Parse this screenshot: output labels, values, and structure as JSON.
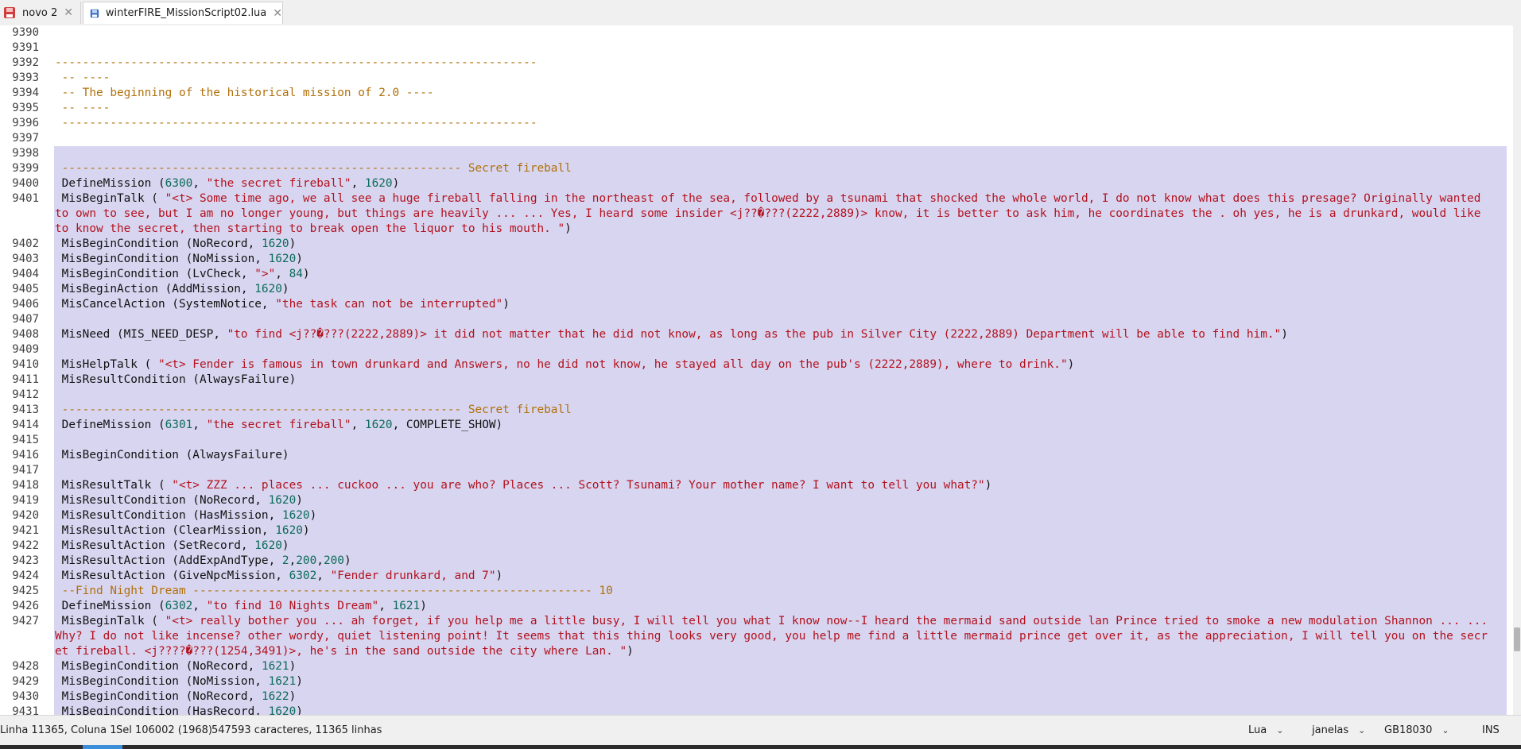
{
  "tabs": [
    {
      "label": "novo 2",
      "icon": "file-modified-icon",
      "color": "#d23c3c"
    },
    {
      "label": "winterFIRE_MissionScript02.lua",
      "icon": "file-saved-icon",
      "color": "#3c72c8"
    }
  ],
  "close_glyph": "✕",
  "editor": {
    "lines": [
      {
        "n": "9390",
        "sel": false,
        "parts": []
      },
      {
        "n": "9391",
        "sel": false,
        "parts": []
      },
      {
        "n": "9392",
        "sel": false,
        "parts": [
          {
            "t": "----------------------------------------------------------------------",
            "k": "c"
          }
        ]
      },
      {
        "n": "9393",
        "sel": false,
        "parts": [
          {
            "t": " -- ----",
            "k": "c"
          }
        ]
      },
      {
        "n": "9394",
        "sel": false,
        "parts": [
          {
            "t": " -- The beginning of the historical mission of 2.0 ----",
            "k": "c"
          }
        ]
      },
      {
        "n": "9395",
        "sel": false,
        "parts": [
          {
            "t": " -- ----",
            "k": "c"
          }
        ]
      },
      {
        "n": "9396",
        "sel": false,
        "parts": [
          {
            "t": " ---------------------------------------------------------------------",
            "k": "c"
          }
        ]
      },
      {
        "n": "9397",
        "sel": false,
        "parts": []
      },
      {
        "n": "9398",
        "sel": true,
        "parts": []
      },
      {
        "n": "9399",
        "sel": true,
        "parts": [
          {
            "t": " ---------------------------------------------------------- Secret fireball",
            "k": "c"
          }
        ]
      },
      {
        "n": "9400",
        "sel": true,
        "parts": [
          {
            "t": " DefineMission (",
            "k": ""
          },
          {
            "t": "6300",
            "k": "n"
          },
          {
            "t": ", ",
            "k": ""
          },
          {
            "t": "\"the secret fireball\"",
            "k": "s"
          },
          {
            "t": ", ",
            "k": ""
          },
          {
            "t": "1620",
            "k": "n"
          },
          {
            "t": ")",
            "k": ""
          }
        ]
      },
      {
        "n": "9401",
        "sel": true,
        "parts": [
          {
            "t": " MisBeginTalk ( ",
            "k": ""
          },
          {
            "t": "\"<t> Some time ago, we all see a huge fireball falling in the northeast of the sea, followed by a tsunami that shocked the whole world, I do not know what does this presage? Originally wanted to own to see, but I am no longer young, but things are heavily ... ... Yes, I heard some insider <j??�???(2222,2889)> know, it is better to ask him, he coordinates the . oh yes, he is a drunkard, would like to know the secret, then starting to break open the liquor to his mouth. \"",
            "k": "s"
          },
          {
            "t": ")",
            "k": ""
          }
        ]
      },
      {
        "n": "9402",
        "sel": true,
        "parts": [
          {
            "t": " MisBeginCondition (NoRecord, ",
            "k": ""
          },
          {
            "t": "1620",
            "k": "n"
          },
          {
            "t": ")",
            "k": ""
          }
        ]
      },
      {
        "n": "9403",
        "sel": true,
        "parts": [
          {
            "t": " MisBeginCondition (NoMission, ",
            "k": ""
          },
          {
            "t": "1620",
            "k": "n"
          },
          {
            "t": ")",
            "k": ""
          }
        ]
      },
      {
        "n": "9404",
        "sel": true,
        "parts": [
          {
            "t": " MisBeginCondition (LvCheck, ",
            "k": ""
          },
          {
            "t": "\">\"",
            "k": "s"
          },
          {
            "t": ", ",
            "k": ""
          },
          {
            "t": "84",
            "k": "n"
          },
          {
            "t": ")",
            "k": ""
          }
        ]
      },
      {
        "n": "9405",
        "sel": true,
        "parts": [
          {
            "t": " MisBeginAction (AddMission, ",
            "k": ""
          },
          {
            "t": "1620",
            "k": "n"
          },
          {
            "t": ")",
            "k": ""
          }
        ]
      },
      {
        "n": "9406",
        "sel": true,
        "parts": [
          {
            "t": " MisCancelAction (SystemNotice, ",
            "k": ""
          },
          {
            "t": "\"the task can not be interrupted\"",
            "k": "s"
          },
          {
            "t": ")",
            "k": ""
          }
        ]
      },
      {
        "n": "9407",
        "sel": true,
        "parts": []
      },
      {
        "n": "9408",
        "sel": true,
        "parts": [
          {
            "t": " MisNeed (MIS_NEED_DESP, ",
            "k": ""
          },
          {
            "t": "\"to find <j??�???(2222,2889)> it did not matter that he did not know, as long as the pub in Silver City (2222,2889) Department will be able to find him.\"",
            "k": "s"
          },
          {
            "t": ")",
            "k": ""
          }
        ]
      },
      {
        "n": "9409",
        "sel": true,
        "parts": []
      },
      {
        "n": "9410",
        "sel": true,
        "parts": [
          {
            "t": " MisHelpTalk ( ",
            "k": ""
          },
          {
            "t": "\"<t> Fender is famous in town drunkard and Answers, no he did not know, he stayed all day on the pub's (2222,2889), where to drink.\"",
            "k": "s"
          },
          {
            "t": ")",
            "k": ""
          }
        ]
      },
      {
        "n": "9411",
        "sel": true,
        "parts": [
          {
            "t": " MisResultCondition (AlwaysFailure)",
            "k": ""
          }
        ]
      },
      {
        "n": "9412",
        "sel": true,
        "parts": []
      },
      {
        "n": "9413",
        "sel": true,
        "parts": [
          {
            "t": " ---------------------------------------------------------- Secret fireball",
            "k": "c"
          }
        ]
      },
      {
        "n": "9414",
        "sel": true,
        "parts": [
          {
            "t": " DefineMission (",
            "k": ""
          },
          {
            "t": "6301",
            "k": "n"
          },
          {
            "t": ", ",
            "k": ""
          },
          {
            "t": "\"the secret fireball\"",
            "k": "s"
          },
          {
            "t": ", ",
            "k": ""
          },
          {
            "t": "1620",
            "k": "n"
          },
          {
            "t": ", COMPLETE_SHOW)",
            "k": ""
          }
        ]
      },
      {
        "n": "9415",
        "sel": true,
        "parts": []
      },
      {
        "n": "9416",
        "sel": true,
        "parts": [
          {
            "t": " MisBeginCondition (AlwaysFailure)",
            "k": ""
          }
        ]
      },
      {
        "n": "9417",
        "sel": true,
        "parts": []
      },
      {
        "n": "9418",
        "sel": true,
        "parts": [
          {
            "t": " MisResultTalk ( ",
            "k": ""
          },
          {
            "t": "\"<t> ZZZ ... places ... cuckoo ... you are who? Places ... Scott? Tsunami? Your mother name? I want to tell you what?\"",
            "k": "s"
          },
          {
            "t": ")",
            "k": ""
          }
        ]
      },
      {
        "n": "9419",
        "sel": true,
        "parts": [
          {
            "t": " MisResultCondition (NoRecord, ",
            "k": ""
          },
          {
            "t": "1620",
            "k": "n"
          },
          {
            "t": ")",
            "k": ""
          }
        ]
      },
      {
        "n": "9420",
        "sel": true,
        "parts": [
          {
            "t": " MisResultCondition (HasMission, ",
            "k": ""
          },
          {
            "t": "1620",
            "k": "n"
          },
          {
            "t": ")",
            "k": ""
          }
        ]
      },
      {
        "n": "9421",
        "sel": true,
        "parts": [
          {
            "t": " MisResultAction (ClearMission, ",
            "k": ""
          },
          {
            "t": "1620",
            "k": "n"
          },
          {
            "t": ")",
            "k": ""
          }
        ]
      },
      {
        "n": "9422",
        "sel": true,
        "parts": [
          {
            "t": " MisResultAction (SetRecord, ",
            "k": ""
          },
          {
            "t": "1620",
            "k": "n"
          },
          {
            "t": ")",
            "k": ""
          }
        ]
      },
      {
        "n": "9423",
        "sel": true,
        "parts": [
          {
            "t": " MisResultAction (AddExpAndType, ",
            "k": ""
          },
          {
            "t": "2",
            "k": "n"
          },
          {
            "t": ",",
            "k": ""
          },
          {
            "t": "200",
            "k": "n"
          },
          {
            "t": ",",
            "k": ""
          },
          {
            "t": "200",
            "k": "n"
          },
          {
            "t": ")",
            "k": ""
          }
        ]
      },
      {
        "n": "9424",
        "sel": true,
        "parts": [
          {
            "t": " MisResultAction (GiveNpcMission, ",
            "k": ""
          },
          {
            "t": "6302",
            "k": "n"
          },
          {
            "t": ", ",
            "k": ""
          },
          {
            "t": "\"Fender drunkard, and 7\"",
            "k": "s"
          },
          {
            "t": ")",
            "k": ""
          }
        ]
      },
      {
        "n": "9425",
        "sel": true,
        "parts": [
          {
            "t": " --Find Night Dream ---------------------------------------------------------- 10",
            "k": "c"
          }
        ]
      },
      {
        "n": "9426",
        "sel": true,
        "parts": [
          {
            "t": " DefineMission (",
            "k": ""
          },
          {
            "t": "6302",
            "k": "n"
          },
          {
            "t": ", ",
            "k": ""
          },
          {
            "t": "\"to find 10 Nights Dream\"",
            "k": "s"
          },
          {
            "t": ", ",
            "k": ""
          },
          {
            "t": "1621",
            "k": "n"
          },
          {
            "t": ")",
            "k": ""
          }
        ]
      },
      {
        "n": "9427",
        "sel": true,
        "parts": [
          {
            "t": " MisBeginTalk ( ",
            "k": ""
          },
          {
            "t": "\"<t> really bother you ... ah forget, if you help me a little busy, I will tell you what I know now--I heard the mermaid sand outside lan Prince tried to smoke a new modulation Shannon ... ... Why? I do not like incense? other wordy, quiet listening point! It seems that this thing looks very good, you help me find a little mermaid prince get over it, as the appreciation, I will tell you on the secret fireball. <j????�???(1254,3491)>, he's in the sand outside the city where Lan. \"",
            "k": "s"
          },
          {
            "t": ")",
            "k": ""
          }
        ]
      },
      {
        "n": "9428",
        "sel": true,
        "parts": [
          {
            "t": " MisBeginCondition (NoRecord, ",
            "k": ""
          },
          {
            "t": "1621",
            "k": "n"
          },
          {
            "t": ")",
            "k": ""
          }
        ]
      },
      {
        "n": "9429",
        "sel": true,
        "parts": [
          {
            "t": " MisBeginCondition (NoMission, ",
            "k": ""
          },
          {
            "t": "1621",
            "k": "n"
          },
          {
            "t": ")",
            "k": ""
          }
        ]
      },
      {
        "n": "9430",
        "sel": true,
        "parts": [
          {
            "t": " MisBeginCondition (NoRecord, ",
            "k": ""
          },
          {
            "t": "1622",
            "k": "n"
          },
          {
            "t": ")",
            "k": ""
          }
        ]
      },
      {
        "n": "9431",
        "sel": true,
        "parts": [
          {
            "t": " MisBeginCondition (HasRecord, ",
            "k": ""
          },
          {
            "t": "1620",
            "k": "n"
          },
          {
            "t": ")",
            "k": ""
          }
        ]
      }
    ]
  },
  "status": {
    "position": "Linha 11365, Coluna 1",
    "selection": "Sel 106002 (1968)",
    "counts": "547593 caracteres, 11365 linhas",
    "language": "Lua",
    "line_endings": "janelas",
    "encoding": "GB18030",
    "mode": "INS"
  },
  "colors": {
    "comment": "#b0700a",
    "string": "#b3121e",
    "number": "#0b6b5a",
    "selection": "#d8d5f0"
  }
}
